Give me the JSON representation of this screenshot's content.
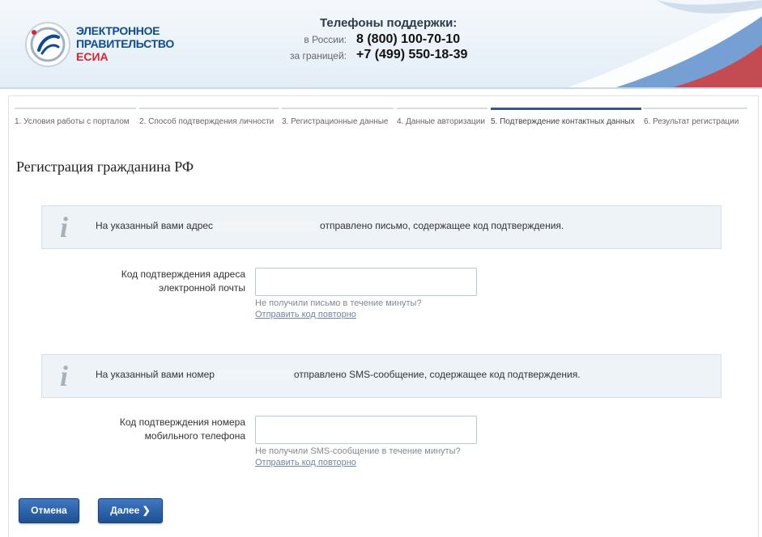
{
  "header": {
    "logo_line1": "ЭЛЕКТРОННОЕ",
    "logo_line2": "ПРАВИТЕЛЬСТВО",
    "logo_line3": "ЕСИА",
    "support_title": "Телефоны поддержки:",
    "phones": [
      {
        "label": "в России:",
        "number": "8 (800) 100-70-10"
      },
      {
        "label": "за границей:",
        "number": "+7 (499) 550-18-39"
      }
    ]
  },
  "steps": [
    {
      "label": "1. Условия работы с порталом",
      "active": false
    },
    {
      "label": "2. Способ подтверждения личности",
      "active": false
    },
    {
      "label": "3. Регистрационные данные",
      "active": false
    },
    {
      "label": "4. Данные авторизации",
      "active": false
    },
    {
      "label": "5. Подтверждение контактных данных",
      "active": true
    },
    {
      "label": "6. Результат регистрации",
      "active": false
    }
  ],
  "page_title": "Регистрация гражданина РФ",
  "email_block": {
    "info_before": "На указанный вами адрес",
    "info_after": "отправлено письмо, содержащее код подтверждения.",
    "field_label": "Код подтверждения адреса электронной почты",
    "field_value": "",
    "hint": "Не получили письмо в течение минуты?",
    "resend": "Отправить код повторно"
  },
  "phone_block": {
    "info_before": "На указанный вами номер",
    "info_after": "отправлено SMS-сообщение, содержащее код подтверждения.",
    "field_label": "Код подтверждения номера мобильного телефона",
    "field_value": "",
    "hint": "Не получили SMS-сообщение в течение минуты?",
    "resend": "Отправить код повторно"
  },
  "buttons": {
    "cancel": "Отмена",
    "next": "Далее ❯"
  },
  "colors": {
    "brand_blue": "#0d4c94",
    "brand_red": "#d7262d",
    "button": "#2a5fa8"
  }
}
